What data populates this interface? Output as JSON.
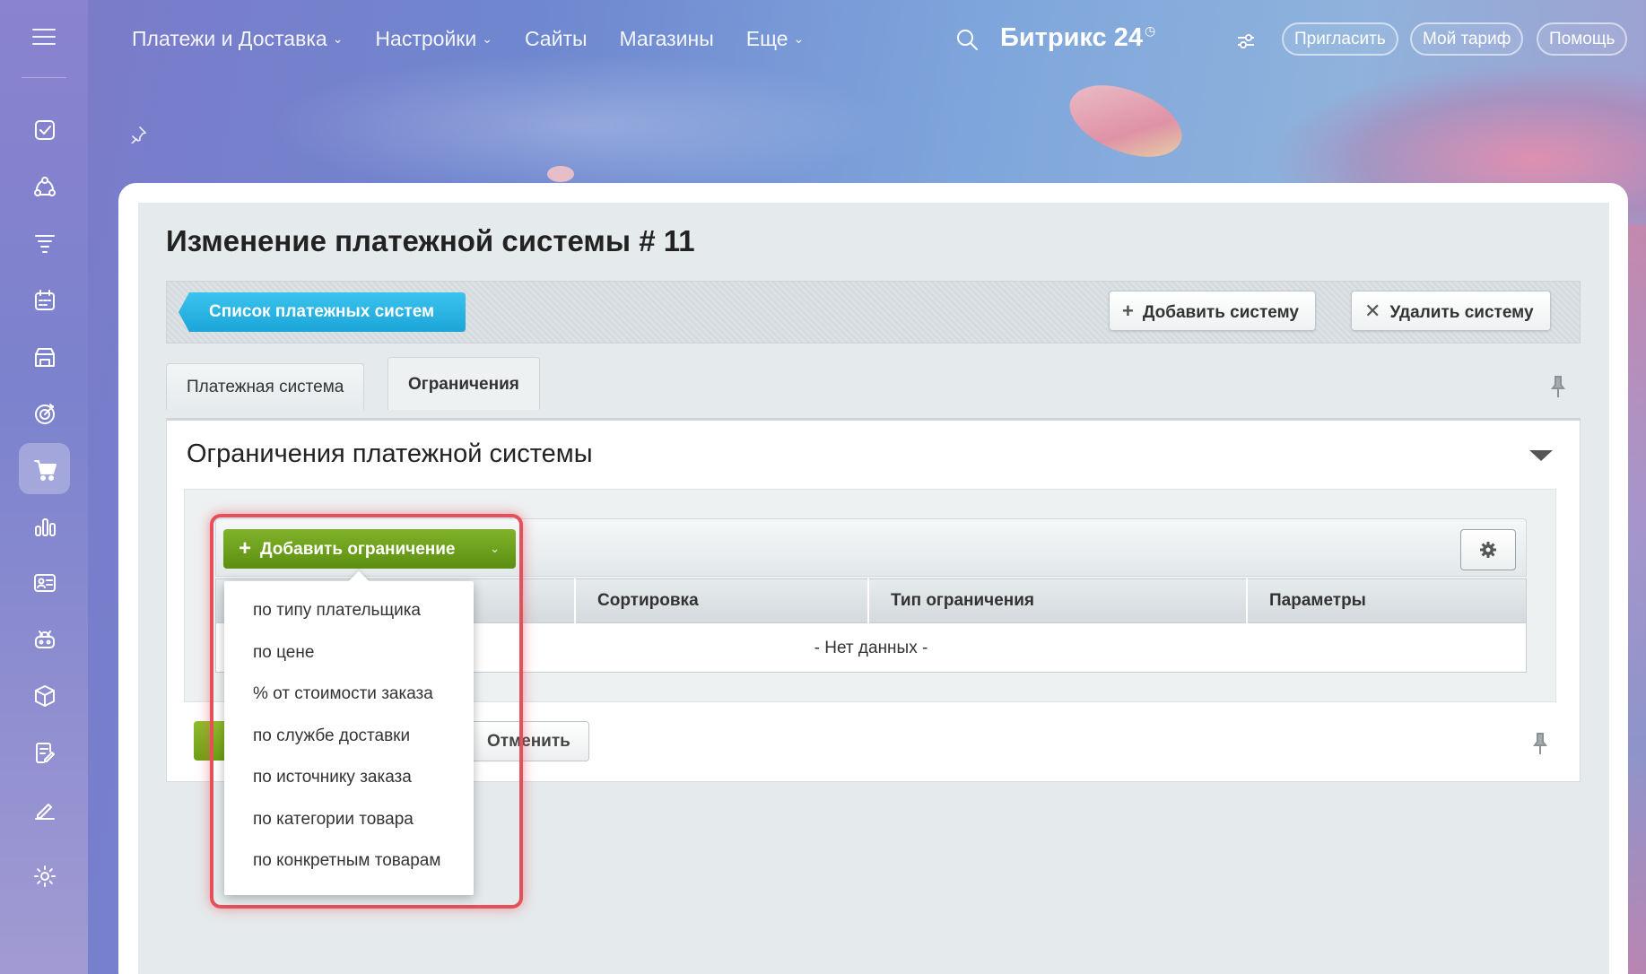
{
  "topbar": {
    "nav": [
      {
        "label": "Платежи и Доставка",
        "chevron": true
      },
      {
        "label": "Настройки",
        "chevron": true
      },
      {
        "label": "Сайты",
        "chevron": false
      },
      {
        "label": "Магазины",
        "chevron": false
      },
      {
        "label": "Еще",
        "chevron": true
      }
    ],
    "logo": "Битрикс",
    "logo_number": "24",
    "invite_label": "Пригласить",
    "tariff_label": "Мой тариф",
    "help_label": "Помощь"
  },
  "sidebar": {
    "items": [
      "tasks-icon",
      "crm-icon",
      "funnel-icon",
      "calendar-icon",
      "store-icon",
      "target-icon",
      "cart-icon",
      "chart-icon",
      "contacts-icon",
      "robot-icon",
      "box-icon",
      "document-icon",
      "sign-icon",
      "settings-icon"
    ],
    "active": "cart-icon"
  },
  "page": {
    "title": "Изменение платежной системы # 11",
    "list_button": "Список платежных систем",
    "add_system_label": "Добавить систему",
    "delete_system_label": "Удалить систему",
    "tabs": [
      {
        "label": "Платежная система",
        "active": false
      },
      {
        "label": "Ограничения",
        "active": true
      }
    ],
    "section_title": "Ограничения платежной системы",
    "add_restriction_label": "Добавить ограничение",
    "columns": [
      "Сортировка",
      "Тип ограничения",
      "Параметры"
    ],
    "empty_text": "- Нет данных -",
    "cancel_label": "Отменить",
    "menu_items": [
      "по типу плательщика",
      "по цене",
      "% от стоимости заказа",
      "по службе доставки",
      "по источнику заказа",
      "по категории товара",
      "по конкретным товарам"
    ]
  },
  "colors": {
    "accent_blue": "#1ba5d8",
    "accent_green": "#6e9f15",
    "highlight_red": "#e5505a"
  }
}
